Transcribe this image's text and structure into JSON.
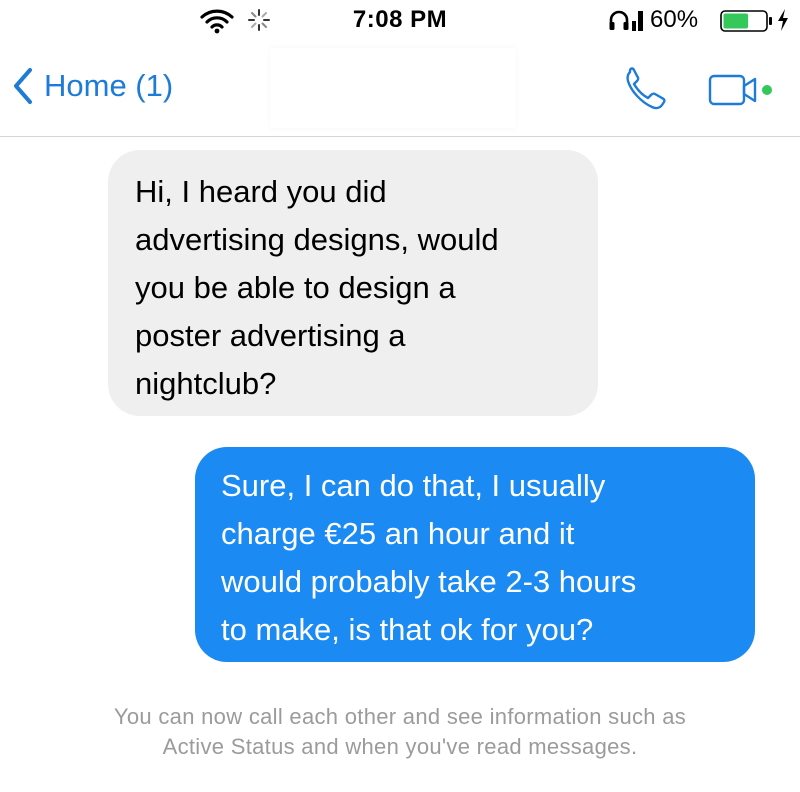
{
  "status_bar": {
    "time": "7:08 PM",
    "battery_percent": "60%",
    "battery_level": 0.6,
    "icons": [
      "wifi-icon",
      "activity-icon",
      "headphones-icon",
      "signal-icon",
      "battery-icon",
      "charging-icon"
    ]
  },
  "nav": {
    "back_label": "Home (1)",
    "icons": [
      "back-chevron-icon",
      "phone-icon",
      "video-camera-icon",
      "online-dot-icon"
    ]
  },
  "messages": [
    {
      "direction": "incoming",
      "lines": [
        "Hi, I heard you did",
        "advertising designs, would",
        "you be able to design a",
        "poster advertising a",
        "nightclub?"
      ]
    },
    {
      "direction": "outgoing",
      "lines": [
        "Sure, I can do that, I usually",
        "charge €25 an hour and it",
        "would probably take 2-3 hours",
        "to make, is that ok for you?"
      ]
    }
  ],
  "notice": {
    "line1": "You can now call each other and see information such as",
    "line2": "Active Status and when you've read messages."
  },
  "colors": {
    "accent": "#1e7bd7",
    "outgoing_bubble": "#1b8af2",
    "incoming_bubble": "#efefef",
    "online": "#34c759",
    "notice_text": "#9b9b9b"
  }
}
